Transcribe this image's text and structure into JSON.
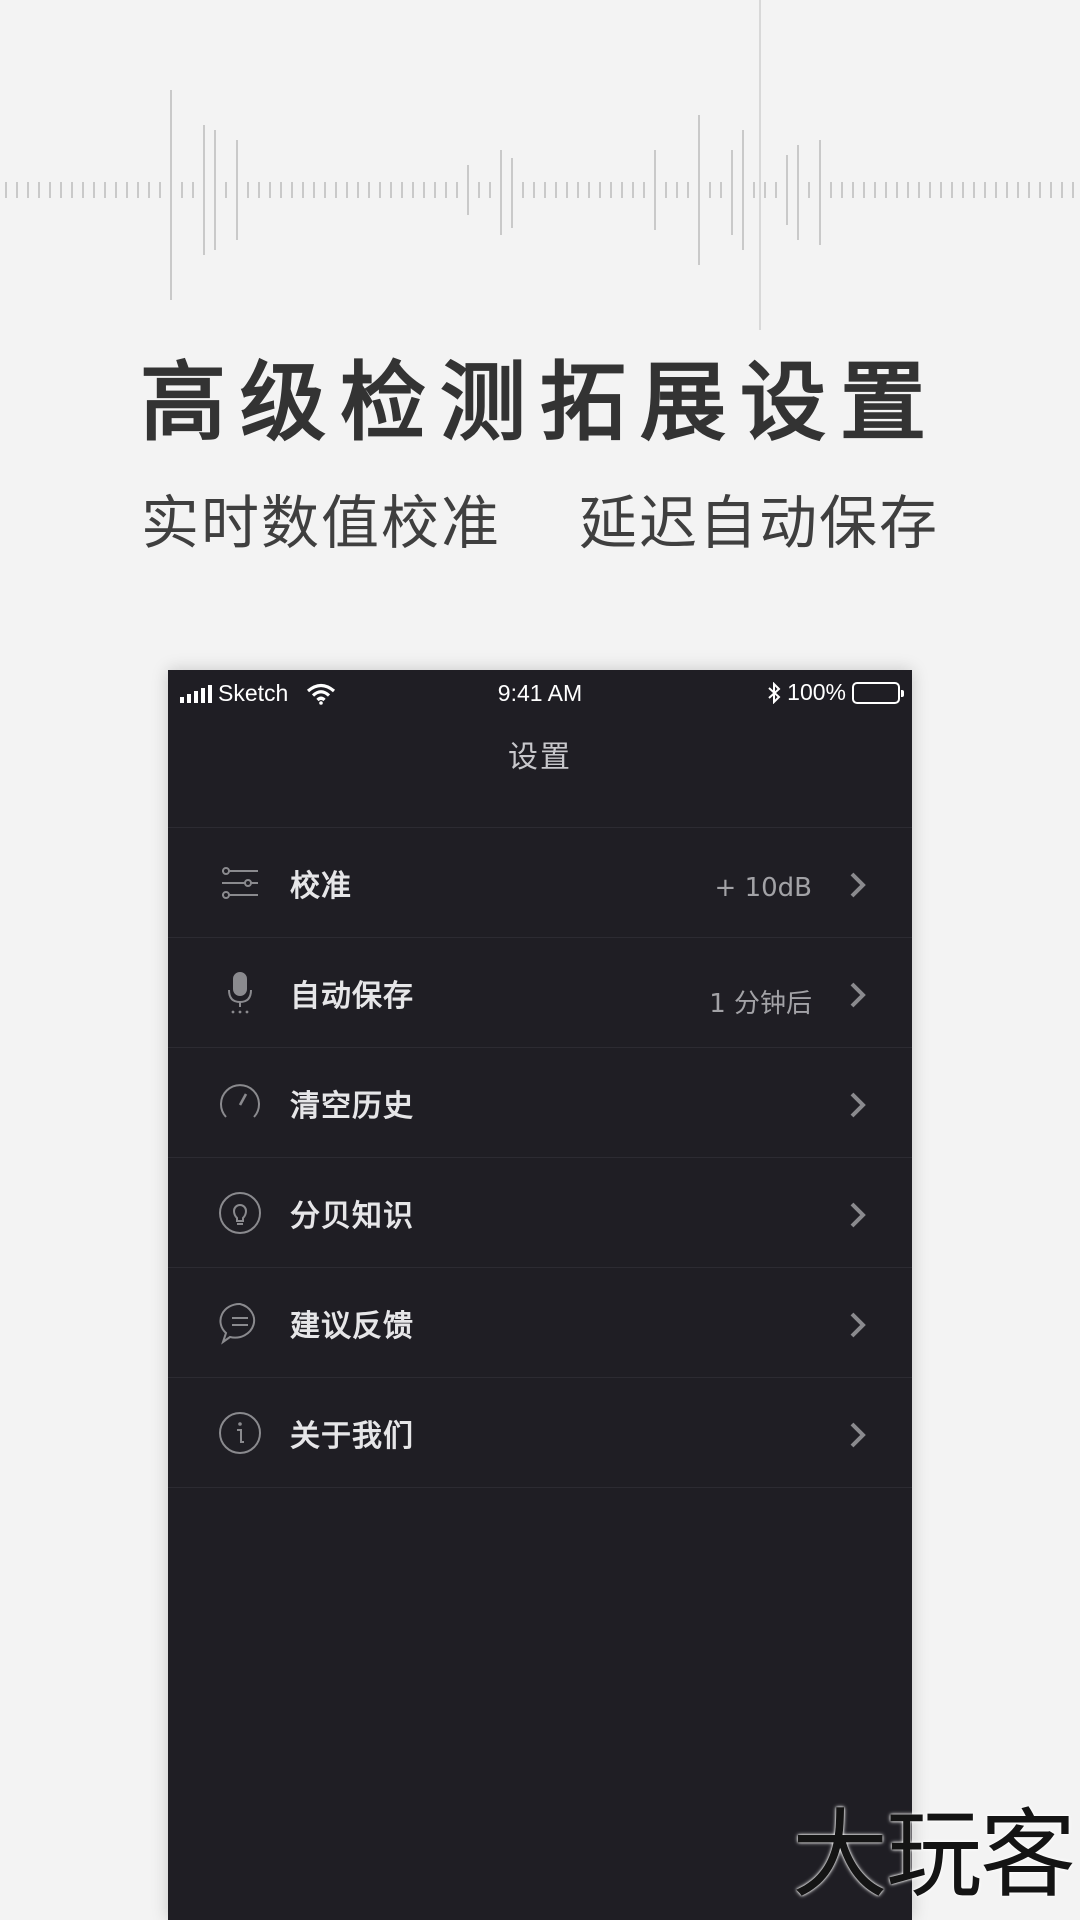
{
  "headline": "高级检测拓展设置",
  "subline": {
    "left": "实时数值校准",
    "right": "延迟自动保存"
  },
  "status_bar": {
    "carrier": "Sketch",
    "time": "9:41 AM",
    "battery": "100%"
  },
  "screen": {
    "title": "设置",
    "items": [
      {
        "label": "校准",
        "value": "+ 10dB",
        "icon": "sliders-icon"
      },
      {
        "label": "自动保存",
        "value": "1 分钟后",
        "icon": "microphone-icon"
      },
      {
        "label": "清空历史",
        "value": "",
        "icon": "gauge-icon"
      },
      {
        "label": "分贝知识",
        "value": "",
        "icon": "lightbulb-icon"
      },
      {
        "label": "建议反馈",
        "value": "",
        "icon": "chat-bubble-icon"
      },
      {
        "label": "关于我们",
        "value": "",
        "icon": "info-icon"
      }
    ]
  },
  "watermark": "大玩客",
  "colors": {
    "page_background": "#f3f3f3",
    "screen_background": "#1f1e24",
    "headline": "#333333"
  }
}
